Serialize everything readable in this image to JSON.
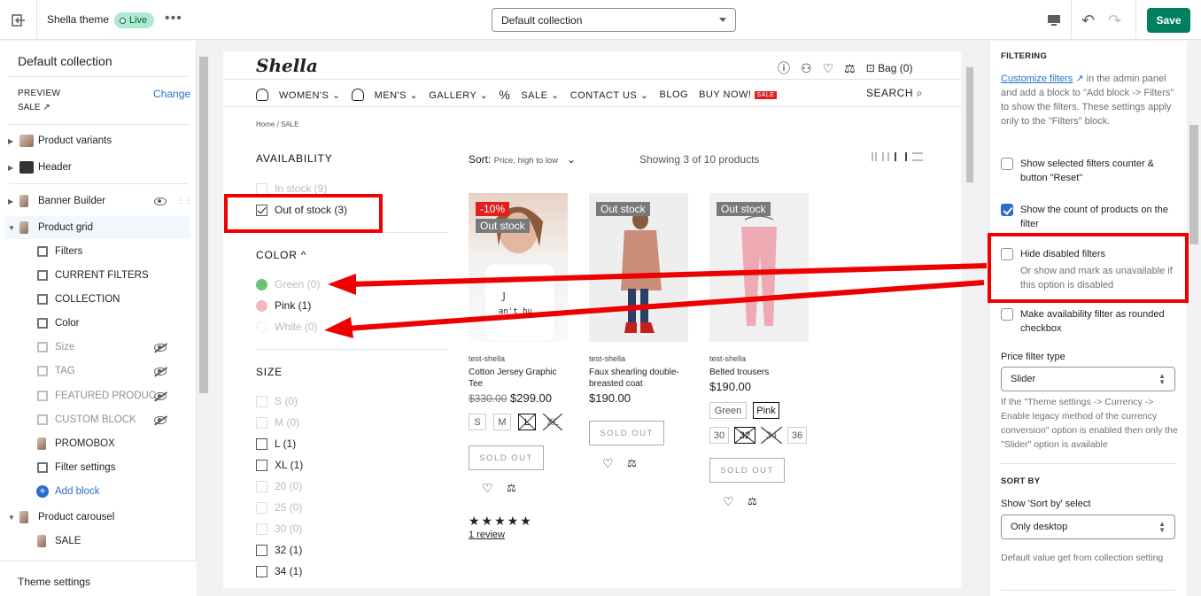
{
  "topbar": {
    "theme_name": "Shella theme",
    "live_label": "Live",
    "more": "•••",
    "template_select": "Default collection",
    "save_label": "Save"
  },
  "sidebar": {
    "title": "Default collection",
    "preview_label": "PREVIEW",
    "preview_value": "SALE ↗",
    "change_label": "Change",
    "items": [
      {
        "label": "Product variants"
      },
      {
        "label": "Header"
      },
      {
        "label": "Banner Builder"
      },
      {
        "label": "Product grid"
      },
      {
        "label": "Filters"
      },
      {
        "label": "CURRENT FILTERS"
      },
      {
        "label": "COLLECTION"
      },
      {
        "label": "Color"
      },
      {
        "label": "Size"
      },
      {
        "label": "TAG"
      },
      {
        "label": "FEATURED PRODUC..."
      },
      {
        "label": "CUSTOM BLOCK"
      },
      {
        "label": "PROMOBOX"
      },
      {
        "label": "Filter settings"
      },
      {
        "label": "Add block"
      },
      {
        "label": "Product carousel"
      },
      {
        "label": "SALE"
      }
    ],
    "theme_settings": "Theme settings"
  },
  "store": {
    "logo": "Shella",
    "bag": "Bag (0)",
    "nav": [
      "WOMEN'S ⌄",
      "MEN'S ⌄",
      "GALLERY ⌄",
      "SALE ⌄",
      "CONTACT US ⌄",
      "BLOG",
      "BUY NOW!"
    ],
    "nav_badge": "SALE",
    "search": "SEARCH",
    "breadcrumb": "Home  /  SALE",
    "availability_title": "AVAILABILITY",
    "availability": [
      {
        "label": "In stock (9)",
        "disabled": true,
        "checked": false
      },
      {
        "label": "Out of stock (3)",
        "disabled": false,
        "checked": true
      }
    ],
    "color_title": "COLOR ^",
    "colors": [
      {
        "label": "Green (0)",
        "color": "#6dbf73",
        "disabled": true
      },
      {
        "label": "Pink (1)",
        "color": "#f4b7c2",
        "disabled": false
      },
      {
        "label": "White (0)",
        "color": "#ffffff",
        "disabled": true
      }
    ],
    "size_title": "SIZE",
    "sizes": [
      {
        "label": "S (0)",
        "disabled": true
      },
      {
        "label": "M (0)",
        "disabled": true
      },
      {
        "label": "L (1)",
        "disabled": false
      },
      {
        "label": "XL (1)",
        "disabled": false
      },
      {
        "label": "20 (0)",
        "disabled": true
      },
      {
        "label": "25 (0)",
        "disabled": true
      },
      {
        "label": "30 (0)",
        "disabled": true
      },
      {
        "label": "32 (1)",
        "disabled": false
      },
      {
        "label": "34 (1)",
        "disabled": false
      }
    ],
    "sort_label": "Sort:",
    "sort_value": "Price, high to low",
    "showing": "Showing 3 of 10 products",
    "products": [
      {
        "badges": [
          "-10%",
          "Out stock"
        ],
        "vendor": "test-shella",
        "title": "Cotton Jersey Graphic Tee",
        "old_price": "$330.00",
        "price": "$299.00",
        "options": [
          "S",
          "M",
          "L",
          "XL"
        ],
        "sold_out": "SOLD OUT"
      },
      {
        "badges": [
          "Out stock"
        ],
        "vendor": "test-shella",
        "title": "Faux shearling double-breasted coat",
        "price": "$190.00",
        "sold_out": "SOLD OUT"
      },
      {
        "badges": [
          "Out stock"
        ],
        "vendor": "test-shella",
        "title": "Belted trousers",
        "price": "$190.00",
        "colors": [
          "Green",
          "Pink"
        ],
        "options": [
          "30",
          "32",
          "34",
          "36"
        ],
        "sold_out": "SOLD OUT"
      }
    ],
    "stars": "★★★★★",
    "review": "1 review"
  },
  "panel": {
    "filtering_title": "FILTERING",
    "customize_link": "Customize filters",
    "customize_text": " in the admin panel and add a block to \"Add block -> Filters\" to show the filters. These settings apply only to the \"Filters\" block.",
    "checks": [
      {
        "label": "Show selected filters counter & button \"Reset\"",
        "checked": false
      },
      {
        "label": "Show the count of products on the filter",
        "checked": true
      },
      {
        "label": "Hide disabled filters",
        "sub": "Or show and mark as unavailable if this option is disabled",
        "checked": false
      },
      {
        "label": "Make availability filter as rounded checkbox",
        "checked": false
      }
    ],
    "price_filter_label": "Price filter type",
    "price_filter_value": "Slider",
    "price_filter_help": "If the \"Theme settings -> Currency -> Enable legacy method of the currency conversion\" option is enabled then only the \"Slider\" option is available",
    "sort_by_title": "SORT BY",
    "show_sort_label": "Show 'Sort by' select",
    "show_sort_value": "Only desktop",
    "sort_help": "Default value get from collection setting"
  },
  "colors": {
    "save": "#008060",
    "link": "#2c6ecb",
    "annotation": "#e00000",
    "sale": "#e21f1f"
  }
}
